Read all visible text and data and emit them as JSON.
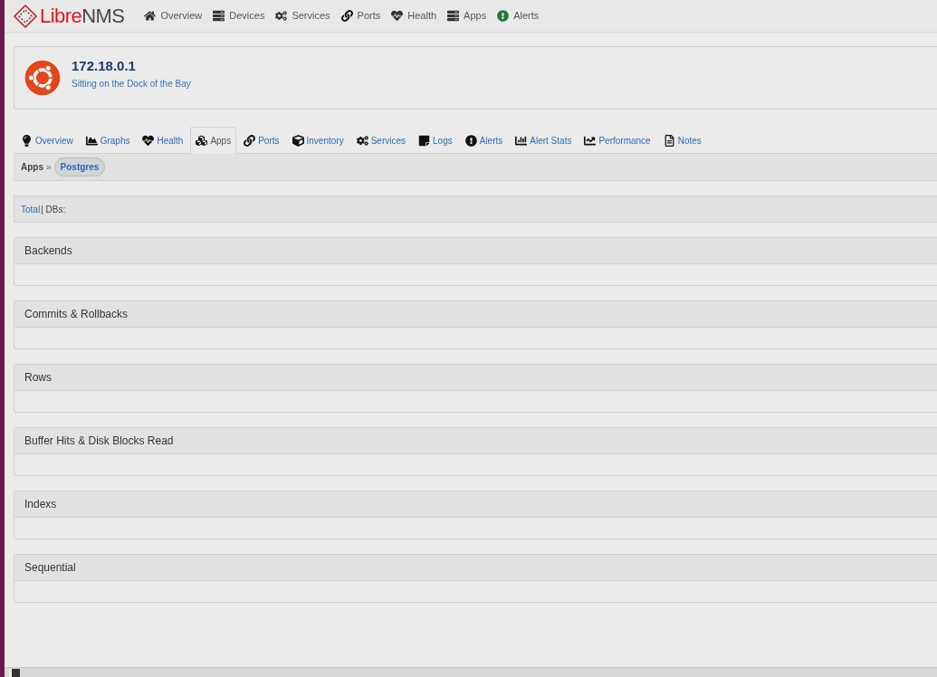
{
  "logo": {
    "part_1": "Libre",
    "part_2": "NMS"
  },
  "nav": [
    {
      "label": "Overview"
    },
    {
      "label": "Devices"
    },
    {
      "label": "Services"
    },
    {
      "label": "Ports"
    },
    {
      "label": "Health"
    },
    {
      "label": "Apps"
    },
    {
      "label": "Alerts"
    }
  ],
  "device": {
    "hostname": "172.18.0.1",
    "location": "Sitting on the Dock of the Bay"
  },
  "tabs": [
    {
      "label": "Overview",
      "selected": false
    },
    {
      "label": "Graphs",
      "selected": false
    },
    {
      "label": "Health",
      "selected": false
    },
    {
      "label": "Apps",
      "selected": true
    },
    {
      "label": "Ports",
      "selected": false
    },
    {
      "label": "Inventory",
      "selected": false
    },
    {
      "label": "Services",
      "selected": false
    },
    {
      "label": "Logs",
      "selected": false
    },
    {
      "label": "Alerts",
      "selected": false
    },
    {
      "label": "Alert Stats",
      "selected": false
    },
    {
      "label": "Performance",
      "selected": false
    },
    {
      "label": "Notes",
      "selected": false
    }
  ],
  "breadcrumb": {
    "label": "Apps",
    "separator": "»",
    "app": "Postgres"
  },
  "filter": {
    "link": "Total",
    "text": "| DBs:"
  },
  "panels": [
    {
      "title": "Backends"
    },
    {
      "title": "Commits & Rollbacks"
    },
    {
      "title": "Rows"
    },
    {
      "title": "Buffer Hits & Disk Blocks Read"
    },
    {
      "title": "Indexs"
    },
    {
      "title": "Sequential"
    }
  ]
}
